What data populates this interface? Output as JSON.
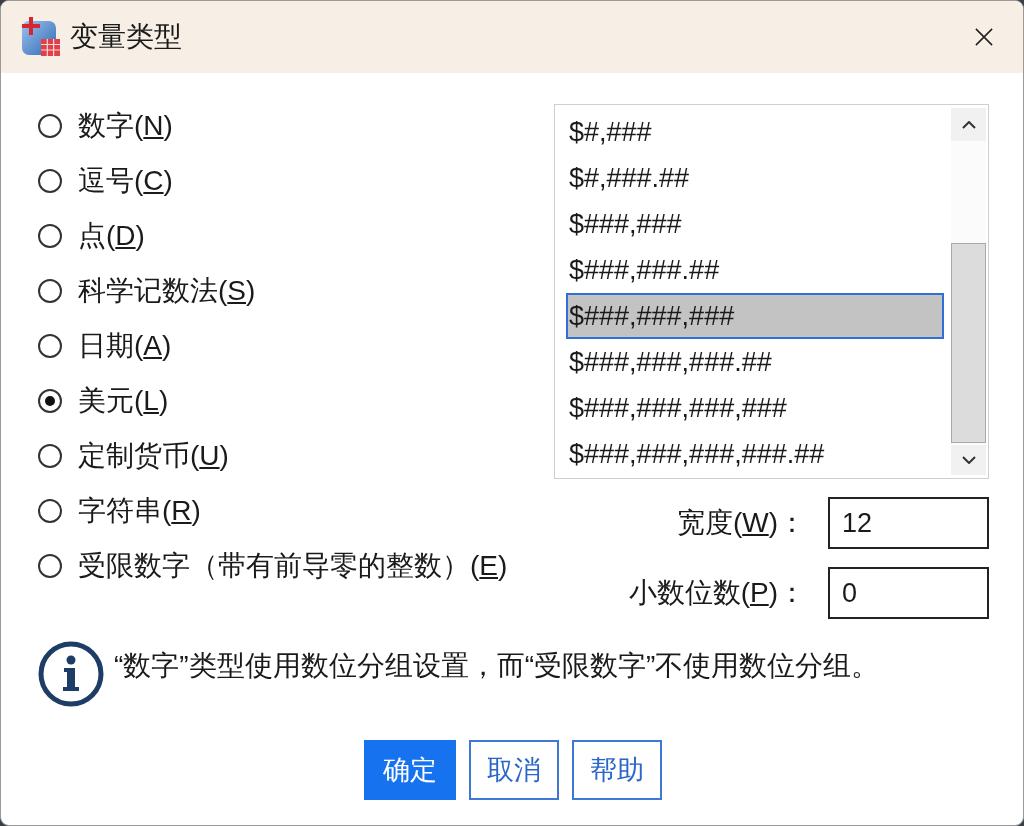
{
  "window": {
    "title": "变量类型"
  },
  "types": [
    {
      "label": "数字(",
      "access_key": "N",
      "label_end": ")",
      "selected": false
    },
    {
      "label": "逗号(",
      "access_key": "C",
      "label_end": ")",
      "selected": false
    },
    {
      "label": "点(",
      "access_key": "D",
      "label_end": ")",
      "selected": false
    },
    {
      "label": "科学记数法(",
      "access_key": "S",
      "label_end": ")",
      "selected": false
    },
    {
      "label": "日期(",
      "access_key": "A",
      "label_end": ")",
      "selected": false
    },
    {
      "label": "美元(",
      "access_key": "L",
      "label_end": ")",
      "selected": true
    },
    {
      "label": "定制货币(",
      "access_key": "U",
      "label_end": ")",
      "selected": false
    },
    {
      "label": "字符串(",
      "access_key": "R",
      "label_end": ")",
      "selected": false
    },
    {
      "label": "受限数字（带有前导零的整数）(",
      "access_key": "E",
      "label_end": ")",
      "selected": false
    }
  ],
  "formats": {
    "items": [
      {
        "text": "$#,###",
        "selected": false
      },
      {
        "text": "$#,###.##",
        "selected": false
      },
      {
        "text": "$###,###",
        "selected": false
      },
      {
        "text": "$###,###.##",
        "selected": false
      },
      {
        "text": "$###,###,###",
        "selected": true
      },
      {
        "text": "$###,###,###.##",
        "selected": false
      },
      {
        "text": "$###,###,###,###",
        "selected": false
      },
      {
        "text": "$###,###,###,###.##",
        "selected": false
      }
    ]
  },
  "fields": [
    {
      "label": "宽度(",
      "access_key": "W",
      "label_end": ")：",
      "value": "12"
    },
    {
      "label": "小数位数(",
      "access_key": "P",
      "label_end": ")：",
      "value": "0"
    }
  ],
  "info": {
    "text": "“数字”类型使用数位分组设置，而“受限数字”不使用数位分组。"
  },
  "buttons": [
    {
      "label": "确定",
      "kind": "primary"
    },
    {
      "label": "取消",
      "kind": "secondary"
    },
    {
      "label": "帮助",
      "kind": "secondary"
    }
  ]
}
